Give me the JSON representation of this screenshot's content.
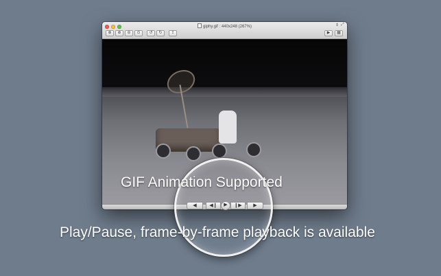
{
  "window": {
    "title": "giphy.gif : 440x248 (267%)",
    "toolbar": {
      "zoom_actual_icon": "zoom-actual-size-icon",
      "zoom_in_icon": "zoom-in-icon",
      "zoom_out_icon": "zoom-out-icon",
      "zoom_fit_icon": "zoom-to-fit-icon",
      "rotate_left_icon": "rotate-left-icon",
      "rotate_right_icon": "rotate-right-icon",
      "share_icon": "share-icon",
      "slideshow_icon": "slideshow-icon",
      "grid_icon": "grid-view-icon"
    }
  },
  "playback": {
    "prev_label": "◀",
    "step_back_label": "◀❙",
    "play_pause_label": "▶",
    "step_forward_label": "❙▶",
    "next_label": "▶"
  },
  "captions": {
    "feature": "GIF Animation Supported",
    "description": "Play/Pause, frame-by-frame playback is available"
  },
  "colors": {
    "background": "#6f7c8c",
    "close": "#f05a52",
    "minimize": "#f5bd3b",
    "zoom": "#5fc24c"
  }
}
